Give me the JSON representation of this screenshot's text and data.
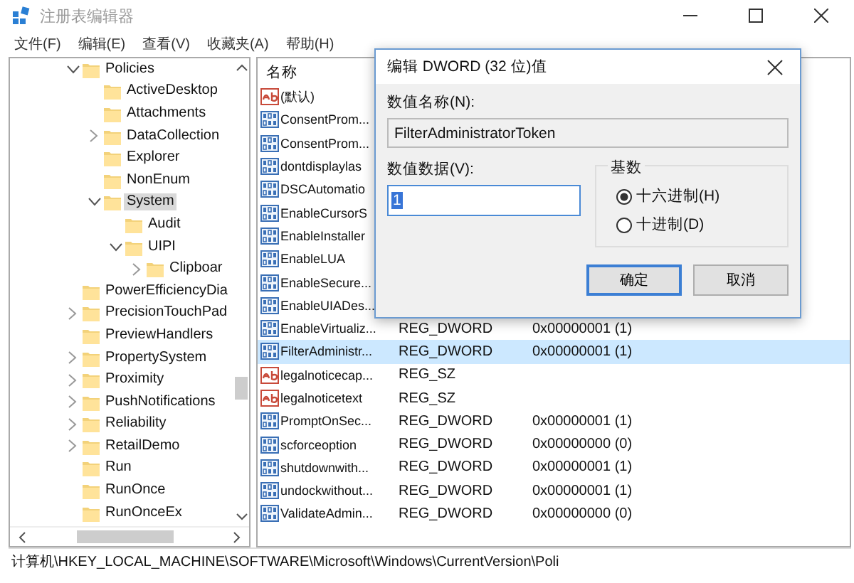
{
  "window": {
    "title": "注册表编辑器"
  },
  "menu": [
    "文件(F)",
    "编辑(E)",
    "查看(V)",
    "收藏夹(A)",
    "帮助(H)"
  ],
  "tree": [
    {
      "label": "Policies",
      "expanded": true,
      "selected": false,
      "children": [
        {
          "label": "ActiveDesktop",
          "selected": false
        },
        {
          "label": "Attachments",
          "selected": false
        },
        {
          "label": "DataCollection",
          "expanded": false,
          "selected": false
        },
        {
          "label": "Explorer",
          "selected": false
        },
        {
          "label": "NonEnum",
          "selected": false
        },
        {
          "label": "System",
          "expanded": true,
          "selected": true,
          "children": [
            {
              "label": "Audit",
              "selected": false
            },
            {
              "label": "UIPI",
              "expanded": true,
              "selected": false,
              "children": [
                {
                  "label": "Clipboar",
                  "expanded": false,
                  "selected": false
                }
              ]
            }
          ]
        }
      ]
    },
    {
      "label": "PowerEfficiencyDia",
      "selected": false
    },
    {
      "label": "PrecisionTouchPad",
      "expanded": false,
      "selected": false
    },
    {
      "label": "PreviewHandlers",
      "selected": false
    },
    {
      "label": "PropertySystem",
      "expanded": false,
      "selected": false
    },
    {
      "label": "Proximity",
      "expanded": false,
      "selected": false
    },
    {
      "label": "PushNotifications",
      "expanded": false,
      "selected": false
    },
    {
      "label": "Reliability",
      "expanded": false,
      "selected": false
    },
    {
      "label": "RetailDemo",
      "expanded": false,
      "selected": false
    },
    {
      "label": "Run",
      "selected": false
    },
    {
      "label": "RunOnce",
      "selected": false
    },
    {
      "label": "RunOnceEx",
      "selected": false
    }
  ],
  "list": {
    "columns": [
      "名称"
    ],
    "rows": [
      {
        "kind": "sz",
        "name": "(默认)",
        "selected": false
      },
      {
        "kind": "dword",
        "name": "ConsentProm...",
        "selected": false
      },
      {
        "kind": "dword",
        "name": "ConsentProm...",
        "selected": false
      },
      {
        "kind": "dword",
        "name": "dontdisplaylas",
        "selected": false
      },
      {
        "kind": "dword",
        "name": "DSCAutomatio",
        "selected": false
      },
      {
        "kind": "dword",
        "name": "EnableCursorS",
        "selected": false
      },
      {
        "kind": "dword",
        "name": "EnableInstaller",
        "selected": false
      },
      {
        "kind": "dword",
        "name": "EnableLUA",
        "selected": false
      },
      {
        "kind": "dword",
        "name": "EnableSecure...",
        "selected": false
      },
      {
        "kind": "dword",
        "name": "EnableUIADes...",
        "selected": false
      },
      {
        "kind": "dword",
        "name": "EnableVirtualiz...",
        "type": "REG_DWORD",
        "data": "0x00000001 (1)",
        "selected": false
      },
      {
        "kind": "dword",
        "name": "FilterAdministr...",
        "type": "REG_DWORD",
        "data": "0x00000001 (1)",
        "selected": true
      },
      {
        "kind": "sz",
        "name": "legalnoticecap...",
        "type": "REG_SZ",
        "selected": false
      },
      {
        "kind": "sz",
        "name": "legalnoticetext",
        "type": "REG_SZ",
        "selected": false
      },
      {
        "kind": "dword",
        "name": "PromptOnSec...",
        "type": "REG_DWORD",
        "data": "0x00000001 (1)",
        "selected": false
      },
      {
        "kind": "dword",
        "name": "scforceoption",
        "type": "REG_DWORD",
        "data": "0x00000000 (0)",
        "selected": false
      },
      {
        "kind": "dword",
        "name": "shutdownwith...",
        "type": "REG_DWORD",
        "data": "0x00000001 (1)",
        "selected": false
      },
      {
        "kind": "dword",
        "name": "undockwithout...",
        "type": "REG_DWORD",
        "data": "0x00000001 (1)",
        "selected": false
      },
      {
        "kind": "dword",
        "name": "ValidateAdmin...",
        "type": "REG_DWORD",
        "data": "0x00000000 (0)",
        "selected": false
      }
    ]
  },
  "status_bar": "计算机\\HKEY_LOCAL_MACHINE\\SOFTWARE\\Microsoft\\Windows\\CurrentVersion\\Poli",
  "dialog": {
    "title": "编辑 DWORD (32 位)值",
    "name_label": "数值名称(N):",
    "name_value": "FilterAdministratorToken",
    "data_label": "数值数据(V):",
    "data_value": "1",
    "base_label": "基数",
    "radios": [
      {
        "label": "十六进制(H)",
        "selected": true
      },
      {
        "label": "十进制(D)",
        "selected": false
      }
    ],
    "buttons": [
      {
        "label": "确定",
        "default": true
      },
      {
        "label": "取消",
        "default": false
      }
    ]
  }
}
